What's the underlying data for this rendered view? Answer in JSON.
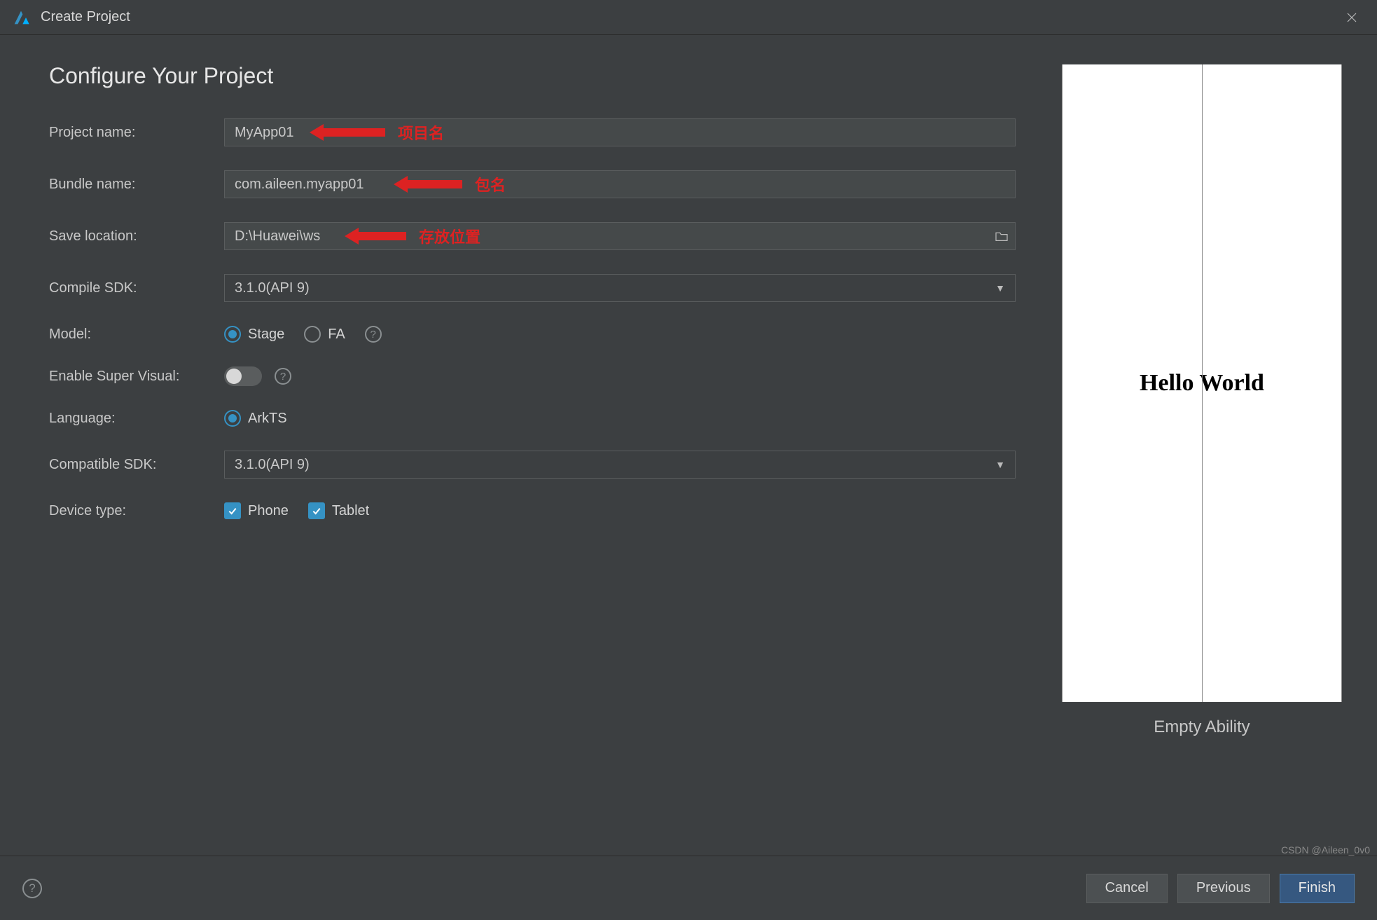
{
  "titlebar": {
    "title": "Create Project"
  },
  "page_title": "Configure Your Project",
  "fields": {
    "project_name": {
      "label": "Project name:",
      "value": "MyApp01"
    },
    "bundle_name": {
      "label": "Bundle name:",
      "value": "com.aileen.myapp01"
    },
    "save_location": {
      "label": "Save location:",
      "value": "D:\\Huawei\\ws"
    },
    "compile_sdk": {
      "label": "Compile SDK:",
      "value": "3.1.0(API 9)"
    },
    "model": {
      "label": "Model:",
      "options": [
        {
          "label": "Stage",
          "selected": true
        },
        {
          "label": "FA",
          "selected": false
        }
      ]
    },
    "enable_super_visual": {
      "label": "Enable Super Visual:",
      "value": false
    },
    "language": {
      "label": "Language:",
      "options": [
        {
          "label": "ArkTS",
          "selected": true
        }
      ]
    },
    "compatible_sdk": {
      "label": "Compatible SDK:",
      "value": "3.1.0(API 9)"
    },
    "device_type": {
      "label": "Device type:",
      "options": [
        {
          "label": "Phone",
          "checked": true
        },
        {
          "label": "Tablet",
          "checked": true
        }
      ]
    }
  },
  "annotations": {
    "project_name": "项目名",
    "bundle_name": "包名",
    "save_location": "存放位置"
  },
  "preview": {
    "text": "Hello World",
    "caption": "Empty Ability"
  },
  "footer": {
    "cancel": "Cancel",
    "previous": "Previous",
    "finish": "Finish"
  },
  "watermark": "CSDN @Aileen_0v0"
}
